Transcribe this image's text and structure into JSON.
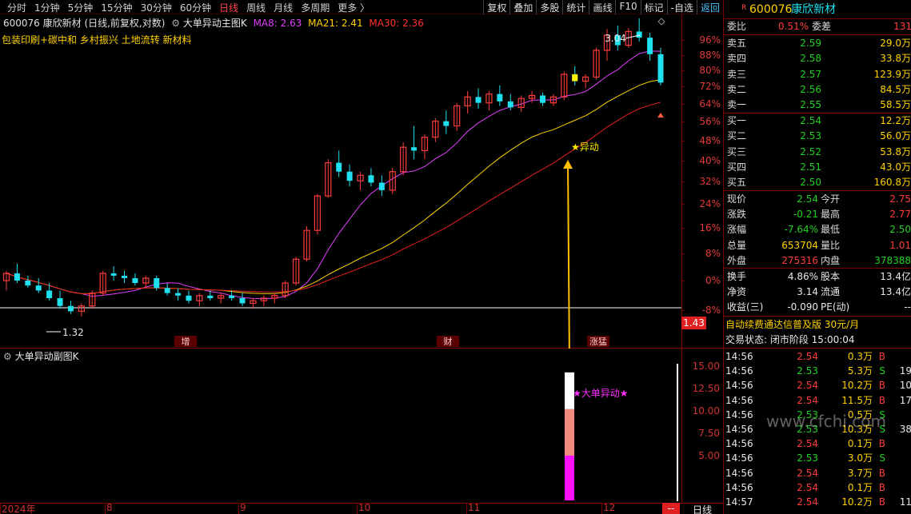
{
  "toolbar": {
    "timeframes": [
      "分时",
      "1分钟",
      "5分钟",
      "15分钟",
      "30分钟",
      "60分钟",
      "日线",
      "周线",
      "月线",
      "多周期",
      "更多 〉"
    ],
    "active_timeframe": "日线",
    "tools": [
      "复权",
      "叠加",
      "多股",
      "统计",
      "画线",
      "F10",
      "标记",
      "-自选"
    ],
    "back_label": "返回"
  },
  "main_chart_header": {
    "stock": "600076 康欣新材 (日线,前复权,对数)",
    "indicator": "大单异动主图K",
    "ma8": "MA8: 2.63",
    "ma21": "MA21: 2.41",
    "ma30": "MA30: 2.36"
  },
  "concept_tags": "包装印刷+碳中和 乡村振兴 土地流转 新材料",
  "sub_chart_header": {
    "indicator": "大单异动副图K"
  },
  "colors": {
    "up": "#ff3b3b",
    "down": "#1ee0ee",
    "ma8": "#e040fb",
    "ma21": "#ffd200",
    "ma30": "#e02020",
    "magenta": "#ff20ff",
    "signal": "#ffee00"
  },
  "chart_data": [
    {
      "type": "candlestick",
      "title": "大单异动主图K",
      "y_axis_labels": [
        "96%",
        "88%",
        "80%",
        "72%",
        "64%",
        "56%",
        "48%",
        "40%",
        "32%",
        "24%",
        "16%",
        "8%",
        "0%",
        "-8%"
      ],
      "price_tag": "1.43",
      "annotations": {
        "high": "3.04",
        "low": "1.32",
        "signal": "★异动"
      },
      "event_markers": [
        "增",
        "财",
        "涨猛"
      ],
      "x_labels": [
        "2024年",
        "8",
        "9",
        "10",
        "11",
        "12"
      ],
      "ohlc": [
        [
          1.46,
          1.5,
          1.42,
          1.49
        ],
        [
          1.49,
          1.53,
          1.45,
          1.46
        ],
        [
          1.46,
          1.48,
          1.43,
          1.44
        ],
        [
          1.44,
          1.47,
          1.41,
          1.42
        ],
        [
          1.42,
          1.45,
          1.38,
          1.39
        ],
        [
          1.39,
          1.42,
          1.35,
          1.36
        ],
        [
          1.36,
          1.38,
          1.33,
          1.34
        ],
        [
          1.34,
          1.37,
          1.32,
          1.36
        ],
        [
          1.36,
          1.42,
          1.35,
          1.41
        ],
        [
          1.41,
          1.5,
          1.4,
          1.49
        ],
        [
          1.49,
          1.52,
          1.46,
          1.48
        ],
        [
          1.48,
          1.5,
          1.45,
          1.47
        ],
        [
          1.47,
          1.49,
          1.44,
          1.45
        ],
        [
          1.45,
          1.48,
          1.43,
          1.47
        ],
        [
          1.47,
          1.48,
          1.42,
          1.43
        ],
        [
          1.43,
          1.45,
          1.4,
          1.41
        ],
        [
          1.41,
          1.43,
          1.38,
          1.4
        ],
        [
          1.4,
          1.42,
          1.37,
          1.38
        ],
        [
          1.38,
          1.41,
          1.36,
          1.4
        ],
        [
          1.4,
          1.42,
          1.38,
          1.39
        ],
        [
          1.39,
          1.41,
          1.37,
          1.4
        ],
        [
          1.4,
          1.42,
          1.38,
          1.39
        ],
        [
          1.39,
          1.41,
          1.36,
          1.37
        ],
        [
          1.37,
          1.39,
          1.35,
          1.38
        ],
        [
          1.38,
          1.4,
          1.36,
          1.39
        ],
        [
          1.39,
          1.41,
          1.37,
          1.4
        ],
        [
          1.4,
          1.46,
          1.39,
          1.45
        ],
        [
          1.45,
          1.56,
          1.44,
          1.55
        ],
        [
          1.55,
          1.7,
          1.54,
          1.68
        ],
        [
          1.68,
          1.86,
          1.66,
          1.85
        ],
        [
          1.85,
          2.05,
          1.84,
          2.03
        ],
        [
          2.03,
          2.1,
          1.95,
          1.98
        ],
        [
          1.98,
          2.02,
          1.9,
          1.93
        ],
        [
          1.93,
          1.98,
          1.88,
          1.96
        ],
        [
          1.96,
          2.0,
          1.9,
          1.92
        ],
        [
          1.92,
          1.96,
          1.85,
          1.88
        ],
        [
          1.88,
          2.0,
          1.86,
          1.98
        ],
        [
          1.98,
          2.15,
          1.96,
          2.12
        ],
        [
          2.12,
          2.25,
          2.05,
          2.1
        ],
        [
          2.1,
          2.2,
          2.05,
          2.18
        ],
        [
          2.18,
          2.3,
          2.15,
          2.28
        ],
        [
          2.28,
          2.35,
          2.2,
          2.25
        ],
        [
          2.25,
          2.4,
          2.22,
          2.38
        ],
        [
          2.38,
          2.48,
          2.33,
          2.44
        ],
        [
          2.44,
          2.5,
          2.36,
          2.4
        ],
        [
          2.4,
          2.48,
          2.35,
          2.46
        ],
        [
          2.46,
          2.52,
          2.38,
          2.41
        ],
        [
          2.41,
          2.46,
          2.35,
          2.37
        ],
        [
          2.37,
          2.45,
          2.34,
          2.43
        ],
        [
          2.43,
          2.48,
          2.4,
          2.45
        ],
        [
          2.45,
          2.47,
          2.38,
          2.4
        ],
        [
          2.4,
          2.46,
          2.38,
          2.44
        ],
        [
          2.44,
          2.62,
          2.42,
          2.6
        ],
        [
          2.6,
          2.66,
          2.52,
          2.55
        ],
        [
          2.55,
          2.6,
          2.5,
          2.58
        ],
        [
          2.58,
          2.8,
          2.56,
          2.78
        ],
        [
          2.78,
          2.95,
          2.7,
          2.9
        ],
        [
          2.9,
          2.98,
          2.78,
          2.82
        ],
        [
          2.82,
          2.96,
          2.8,
          2.93
        ],
        [
          2.93,
          3.04,
          2.85,
          2.88
        ],
        [
          2.88,
          2.92,
          2.7,
          2.75
        ],
        [
          2.75,
          2.8,
          2.52,
          2.54
        ]
      ]
    },
    {
      "type": "bar",
      "title": "大单异动副图K",
      "y_axis_labels": [
        "15.00",
        "12.50",
        "10.00",
        "7.50",
        "5.00"
      ],
      "ylim": [
        0,
        16
      ],
      "values": [
        5.0,
        10.2,
        14.3
      ],
      "colors": [
        "#ff10ff",
        "#f08a80",
        "#ffffff"
      ],
      "annotation": "★大单异动★"
    }
  ],
  "quote_panel": {
    "code": "600076",
    "name": "康欣新材",
    "weibi_label": "委比",
    "weibi": "0.51%",
    "weicha_label": "委差",
    "weicha": "131",
    "asks": [
      {
        "label": "卖五",
        "price": "2.59",
        "vol": "29.0万"
      },
      {
        "label": "卖四",
        "price": "2.58",
        "vol": "33.8万"
      },
      {
        "label": "卖三",
        "price": "2.57",
        "vol": "123.9万"
      },
      {
        "label": "卖二",
        "price": "2.56",
        "vol": "84.5万"
      },
      {
        "label": "卖一",
        "price": "2.55",
        "vol": "58.5万"
      }
    ],
    "bids": [
      {
        "label": "买一",
        "price": "2.54",
        "vol": "12.2万"
      },
      {
        "label": "买二",
        "price": "2.53",
        "vol": "56.0万"
      },
      {
        "label": "买三",
        "price": "2.52",
        "vol": "53.8万"
      },
      {
        "label": "买四",
        "price": "2.51",
        "vol": "43.0万"
      },
      {
        "label": "买五",
        "price": "2.50",
        "vol": "160.8万"
      }
    ],
    "stats": [
      {
        "l1": "现价",
        "v1": "2.54",
        "c1": "g",
        "l2": "今开",
        "v2": "2.75",
        "c2": "r"
      },
      {
        "l1": "涨跌",
        "v1": "-0.21",
        "c1": "g",
        "l2": "最高",
        "v2": "2.77",
        "c2": "r"
      },
      {
        "l1": "涨幅",
        "v1": "-7.64%",
        "c1": "g",
        "l2": "最低",
        "v2": "2.50",
        "c2": "g"
      },
      {
        "l1": "总量",
        "v1": "653704",
        "c1": "y",
        "l2": "量比",
        "v2": "1.01",
        "c2": "r"
      },
      {
        "l1": "外盘",
        "v1": "275316",
        "c1": "r",
        "l2": "内盘",
        "v2": "378388",
        "c2": "g"
      }
    ],
    "stats2": [
      {
        "l1": "换手",
        "v1": "4.86%",
        "l2": "股本",
        "v2": "13.4亿"
      },
      {
        "l1": "净资",
        "v1": "3.14",
        "l2": "流通",
        "v2": "13.4亿"
      },
      {
        "l1": "收益(三)",
        "v1": "-0.090",
        "l2": "PE(动)",
        "v2": "--"
      }
    ],
    "promo": "自动续费通达信普及版  30元/月",
    "trade_status": "交易状态: 闭市阶段 15:00:04",
    "ticks": [
      {
        "t": "14:56",
        "p": "2.54",
        "v": "0.3万",
        "d": "B",
        "n": ""
      },
      {
        "t": "14:56",
        "p": "2.53",
        "v": "5.3万",
        "d": "S",
        "n": "19"
      },
      {
        "t": "14:56",
        "p": "2.54",
        "v": "10.2万",
        "d": "B",
        "n": "10"
      },
      {
        "t": "14:56",
        "p": "2.54",
        "v": "11.5万",
        "d": "B",
        "n": "17"
      },
      {
        "t": "14:56",
        "p": "2.53",
        "v": "0.5万",
        "d": "S",
        "n": ""
      },
      {
        "t": "14:56",
        "p": "2.53",
        "v": "10.3万",
        "d": "S",
        "n": "38"
      },
      {
        "t": "14:56",
        "p": "2.54",
        "v": "0.1万",
        "d": "B",
        "n": ""
      },
      {
        "t": "14:56",
        "p": "2.53",
        "v": "3.0万",
        "d": "S",
        "n": ""
      },
      {
        "t": "14:56",
        "p": "2.54",
        "v": "3.7万",
        "d": "B",
        "n": ""
      },
      {
        "t": "14:56",
        "p": "2.54",
        "v": "0.1万",
        "d": "B",
        "n": ""
      },
      {
        "t": "14:57",
        "p": "2.54",
        "v": "10.2万",
        "d": "B",
        "n": "11"
      }
    ]
  },
  "watermark": "www.cfchi.com",
  "bottom_tab": "日线",
  "bottom_dash": "--"
}
